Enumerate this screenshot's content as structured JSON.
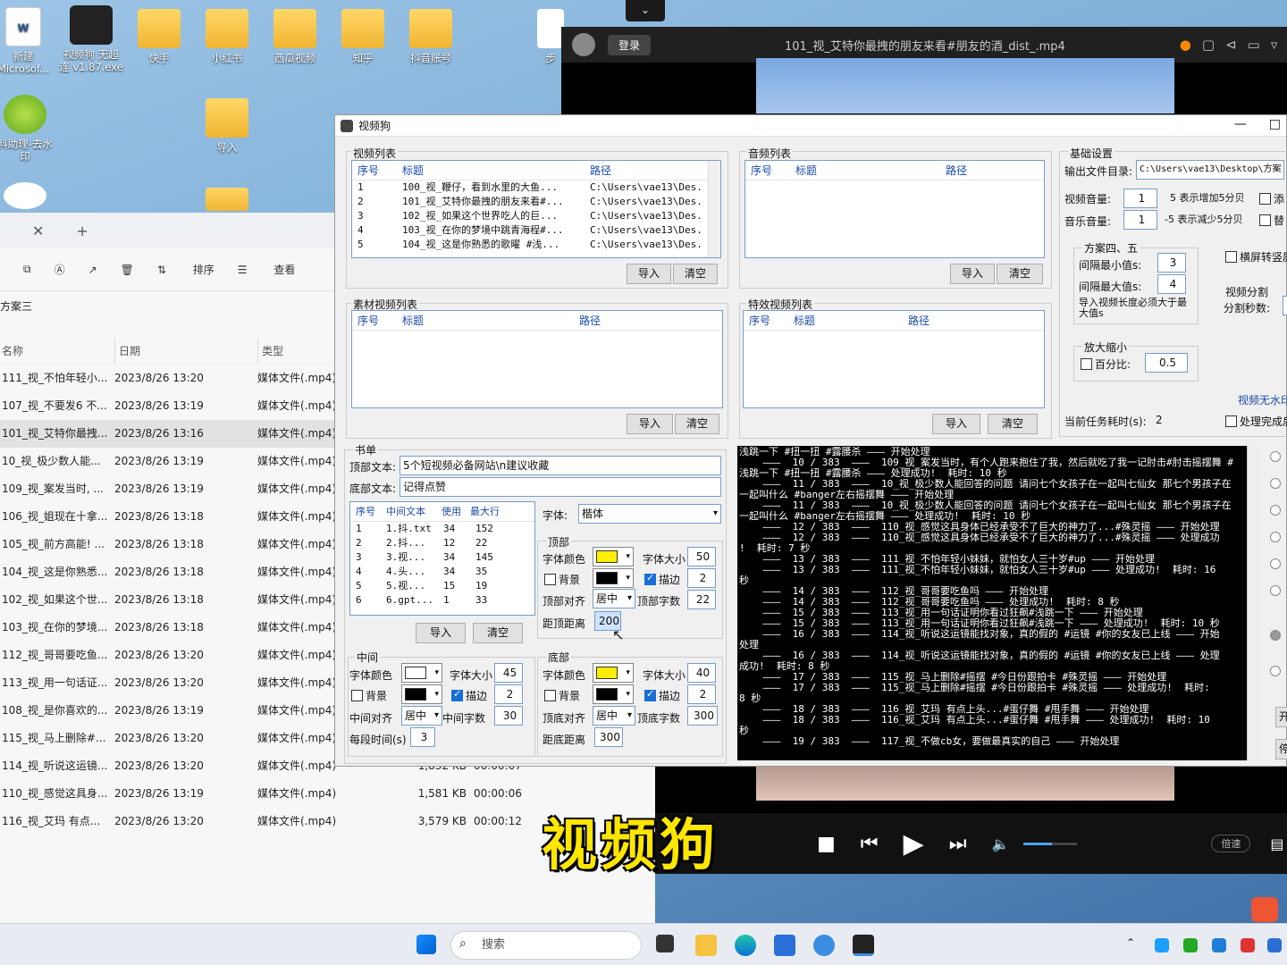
{
  "desktop": {
    "icons": [
      {
        "label": "新建\nMicrosof...",
        "name": "word-doc"
      },
      {
        "label": "视频狗 无超\n连 v1.87.exe",
        "name": "videodog-exe"
      },
      {
        "label": "快手",
        "name": "folder-kuaishou"
      },
      {
        "label": "小红书",
        "name": "folder-xiaohongshu"
      },
      {
        "label": "西瓜视频",
        "name": "folder-xigua"
      },
      {
        "label": "知乎",
        "name": "folder-zhihu"
      },
      {
        "label": "抖音账号",
        "name": "folder-douyin"
      },
      {
        "label": "步",
        "name": "file-step"
      },
      {
        "label": "料助理-去水\n印",
        "name": "app-watermark"
      },
      {
        "label": "导入",
        "name": "folder-import"
      }
    ]
  },
  "player": {
    "login": "登录",
    "title": "101_视_艾特你最拽的朋友来看#朋友的酒_dist_.mp4",
    "speed": "倍速",
    "collapse": "⌄",
    "subtitle": "视频狗"
  },
  "explorer": {
    "tab_close": "✕",
    "tab_add": "+",
    "toolbar": {
      "sort": "排序",
      "view": "查看"
    },
    "breadcrumb": "方案三",
    "headers": {
      "name": "名称",
      "date": "日期",
      "type": "类型"
    },
    "rows": [
      {
        "name": "111_视_不怕年轻小...",
        "date": "2023/8/26 13:20",
        "type": "媒体文件(.mp4)",
        "size": "",
        "dur": ""
      },
      {
        "name": "107_视_不要发6 不...",
        "date": "2023/8/26 13:19",
        "type": "媒体文件(.mp4)",
        "size": "",
        "dur": ""
      },
      {
        "name": "101_视_艾特你最拽...",
        "date": "2023/8/26 13:16",
        "type": "媒体文件(.mp4)",
        "size": "",
        "dur": ""
      },
      {
        "name": "10_视_极少数人能...",
        "date": "2023/8/26 13:19",
        "type": "媒体文件(.mp4)",
        "size": "",
        "dur": ""
      },
      {
        "name": "109_视_案发当时, ...",
        "date": "2023/8/26 13:19",
        "type": "媒体文件(.mp4)",
        "size": "",
        "dur": ""
      },
      {
        "name": "106_视_姐现在十拿...",
        "date": "2023/8/26 13:18",
        "type": "媒体文件(.mp4)",
        "size": "",
        "dur": ""
      },
      {
        "name": "105_视_前方高能! ...",
        "date": "2023/8/26 13:18",
        "type": "媒体文件(.mp4)",
        "size": "",
        "dur": ""
      },
      {
        "name": "104_视_这是你熟悉...",
        "date": "2023/8/26 13:18",
        "type": "媒体文件(.mp4)",
        "size": "",
        "dur": ""
      },
      {
        "name": "102_视_如果这个世...",
        "date": "2023/8/26 13:18",
        "type": "媒体文件(.mp4)",
        "size": "",
        "dur": ""
      },
      {
        "name": "103_视_在你的梦境...",
        "date": "2023/8/26 13:18",
        "type": "媒体文件(.mp4)",
        "size": "",
        "dur": ""
      },
      {
        "name": "112_视_哥哥要吃鱼...",
        "date": "2023/8/26 13:20",
        "type": "媒体文件(.mp4)",
        "size": "",
        "dur": ""
      },
      {
        "name": "113_视_用一句话证...",
        "date": "2023/8/26 13:20",
        "type": "媒体文件(.mp4)",
        "size": "",
        "dur": ""
      },
      {
        "name": "108_视_是你喜欢的...",
        "date": "2023/8/26 13:19",
        "type": "媒体文件(.mp4)",
        "size": "",
        "dur": ""
      },
      {
        "name": "115_视_马上删除#...",
        "date": "2023/8/26 13:20",
        "type": "媒体文件(.mp4)",
        "size": "",
        "dur": ""
      },
      {
        "name": "114_视_听说这运镜...",
        "date": "2023/8/26 13:20",
        "type": "媒体文件(.mp4)",
        "size": "1,832 KB",
        "dur": "00:00:07"
      },
      {
        "name": "110_视_感觉这具身...",
        "date": "2023/8/26 13:19",
        "type": "媒体文件(.mp4)",
        "size": "1,581 KB",
        "dur": "00:00:06"
      },
      {
        "name": "116_视_艾玛 有点...",
        "date": "2023/8/26 13:20",
        "type": "媒体文件(.mp4)",
        "size": "3,579 KB",
        "dur": "00:00:12"
      }
    ]
  },
  "app": {
    "title": "视频狗",
    "video_list": {
      "label": "视频列表",
      "headers": [
        "序号",
        "标题",
        "路径"
      ],
      "rows": [
        [
          "1",
          "100_视_鞭仔，看到水里的大鱼...",
          "C:\\Users\\vae13\\Des..."
        ],
        [
          "2",
          "101_视_艾特你最拽的朋友来看#...",
          "C:\\Users\\vae13\\Des..."
        ],
        [
          "3",
          "102_视_如果这个世界吃人的巨...",
          "C:\\Users\\vae13\\Des..."
        ],
        [
          "4",
          "103_视_在你的梦境中跳青海程#...",
          "C:\\Users\\vae13\\Des..."
        ],
        [
          "5",
          "104_视_这是你熟悉的歌曜 #浅...",
          "C:\\Users\\vae13\\Des..."
        ]
      ],
      "import": "导入",
      "clear": "清空"
    },
    "audio_list": {
      "label": "音频列表",
      "headers": [
        "序号",
        "标题",
        "路径"
      ],
      "import": "导入",
      "clear": "清空"
    },
    "material_list": {
      "label": "素材视频列表",
      "headers": [
        "序号",
        "标题",
        "路径"
      ],
      "import": "导入",
      "clear": "清空"
    },
    "effect_list": {
      "label": "特效视频列表",
      "headers": [
        "序号",
        "标题",
        "路径"
      ],
      "import": "导入",
      "clear": "清空"
    },
    "basic": {
      "label": "基础设置",
      "out_dir_label": "输出文件目录:",
      "out_dir": "C:\\Users\\vae13\\Desktop\\方案",
      "video_vol_label": "视频音量:",
      "video_vol": "1",
      "video_vol_hint": "5 表示增加5分贝",
      "music_vol_label": "音乐音量:",
      "music_vol": "1",
      "music_vol_hint": "-5 表示减少5分贝",
      "opt1": "添",
      "opt2": "替",
      "plan_label": "方案四、五",
      "min_label": "间隔最小值s:",
      "min": "3",
      "max_label": "间隔最大值s:",
      "max": "4",
      "import_note": "导入视频长度必须大于最大值s",
      "landscape": "横屏转竖屏",
      "split_label": "视频分割",
      "split_sec_label": "分割秒数:",
      "zoom_label": "放大缩小",
      "percent_label": "百分比:",
      "percent": "0.5",
      "nowm": "视频无水印",
      "elapsed_label": "当前任务耗时(s):",
      "elapsed": "2",
      "done_label": "处理完成后"
    },
    "book": {
      "label": "书单",
      "top_label": "顶部文本:",
      "top": "5个短视频必备网站\\n建议收藏",
      "bottom_label": "底部文本:",
      "bottom": "记得点赞",
      "headers": [
        "序号",
        "中间文本",
        "使用",
        "最大行"
      ],
      "rows": [
        [
          "1",
          "1.抖.txt",
          "34",
          "152"
        ],
        [
          "2",
          "2.抖...",
          "12",
          "22"
        ],
        [
          "3",
          "3.视...",
          "34",
          "145"
        ],
        [
          "4",
          "4.头...",
          "34",
          "35"
        ],
        [
          "5",
          "5.视...",
          "15",
          "19"
        ],
        [
          "6",
          "6.gpt...",
          "1",
          "33"
        ]
      ],
      "import": "导入",
      "clear": "清空",
      "font_label": "字体:",
      "font": "楷体",
      "top_group": "顶部",
      "top_color_label": "字体颜色",
      "top_size_label": "字体大小",
      "top_size": "50",
      "top_bg": "背景",
      "top_stroke": "描边",
      "top_stroke_val": "2",
      "top_align_label": "顶部对齐",
      "top_align": "居中",
      "top_chars_label": "顶部字数",
      "top_chars": "22",
      "top_dist_label": "距顶距离",
      "top_dist": "200",
      "mid_group": "中间",
      "mid_color_label": "字体颜色",
      "mid_size_label": "字体大小",
      "mid_size": "45",
      "mid_bg": "背景",
      "mid_stroke": "描边",
      "mid_stroke_val": "2",
      "mid_align_label": "中间对齐",
      "mid_align": "居中",
      "mid_chars_label": "中间字数",
      "mid_chars": "30",
      "mid_time_label": "每段时间(s)",
      "mid_time": "3",
      "bot_group": "底部",
      "bot_color_label": "字体颜色",
      "bot_size_label": "字体大小",
      "bot_size": "40",
      "bot_bg": "背景",
      "bot_stroke": "描边",
      "bot_stroke_val": "2",
      "bot_align_label": "顶底对齐",
      "bot_align": "居中",
      "bot_chars_label": "顶底字数",
      "bot_chars": "300",
      "bot_dist_label": "距底距离",
      "bot_dist": "300"
    },
    "log": [
      "浅跳一下 #扭一扭 #露腰杀 ——— 开始处理",
      "    ———  10 / 383  ———  109_视_案发当时，有个人跑来抱住了我，然后就吃了我一记肘击#肘击摇摆舞 #",
      "浅跳一下 #扭一扭 #露腰杀 ——— 处理成功!  耗时: 10 秒",
      "    ———  11 / 383  ———  10_视_极少数人能回答的问题 请问七个女孩子在一起叫七仙女 那七个男孩子在",
      "一起叫什么 #banger左右摇摆舞 ——— 开始处理",
      "    ———  11 / 383  ———  10_视_极少数人能回答的问题 请问七个女孩子在一起叫七仙女 那七个男孩子在",
      "一起叫什么 #banger左右摇摆舞 ——— 处理成功!  耗时: 10 秒",
      "    ———  12 / 383  ———  110_视_感觉这具身体已经承受不了巨大的神力了...#殊灵摇 ——— 开始处理",
      "    ———  12 / 383  ———  110_视_感觉这具身体已经承受不了巨大的神力了...#殊灵摇 ——— 处理成功",
      "!  耗时: 7 秒",
      "    ———  13 / 383  ———  111_视_不怕年轻小妹妹，就怕女人三十岁#up ——— 开始处理",
      "    ———  13 / 383  ———  111_视_不怕年轻小妹妹，就怕女人三十岁#up ——— 处理成功!  耗时: 16",
      "秒",
      "    ———  14 / 383  ———  112_视_哥哥要吃鱼吗 ——— 开始处理",
      "    ———  14 / 383  ———  112_视_哥哥要吃鱼吗 ——— 处理成功!  耗时: 8 秒",
      "    ———  15 / 383  ———  113_视_用一句话证明你看过狂飙#浅跳一下 ——— 开始处理",
      "    ———  15 / 383  ———  113_视_用一句话证明你看过狂飙#浅跳一下 ——— 处理成功!  耗时: 10 秒",
      "    ———  16 / 383  ———  114_视_听说这运镜能找对象，真的假的 #运镜 #你的女友已上线 ——— 开始",
      "处理",
      "    ———  16 / 383  ———  114_视_听说这运镜能找对象，真的假的 #运镜 #你的女友已上线 ——— 处理",
      "成功!  耗时: 8 秒",
      "    ———  17 / 383  ———  115_视_马上删除#摇摆 #今日份跟拍卡 #殊灵摇 ——— 开始处理",
      "    ———  17 / 383  ———  115_视_马上删除#摇摆 #今日份跟拍卡 #殊灵摇 ——— 处理成功!  耗时:",
      "8 秒",
      "    ———  18 / 383  ———  116_视_艾玛 有点上头...#蛋仔舞 #甩手舞 ——— 开始处理",
      "    ———  18 / 383  ———  116_视_艾玛 有点上头...#蛋仔舞 #甩手舞 ——— 处理成功!  耗时: 10",
      "秒",
      "    ———  19 / 383  ———  117_视_不做cb女，要做最真实的自己 ——— 开始处理"
    ],
    "right_edge": [
      "开",
      "停"
    ]
  },
  "taskbar": {
    "search": "搜索"
  },
  "colors": {
    "yellow": "#ffee00",
    "black": "#000000",
    "white": "#ffffff"
  }
}
